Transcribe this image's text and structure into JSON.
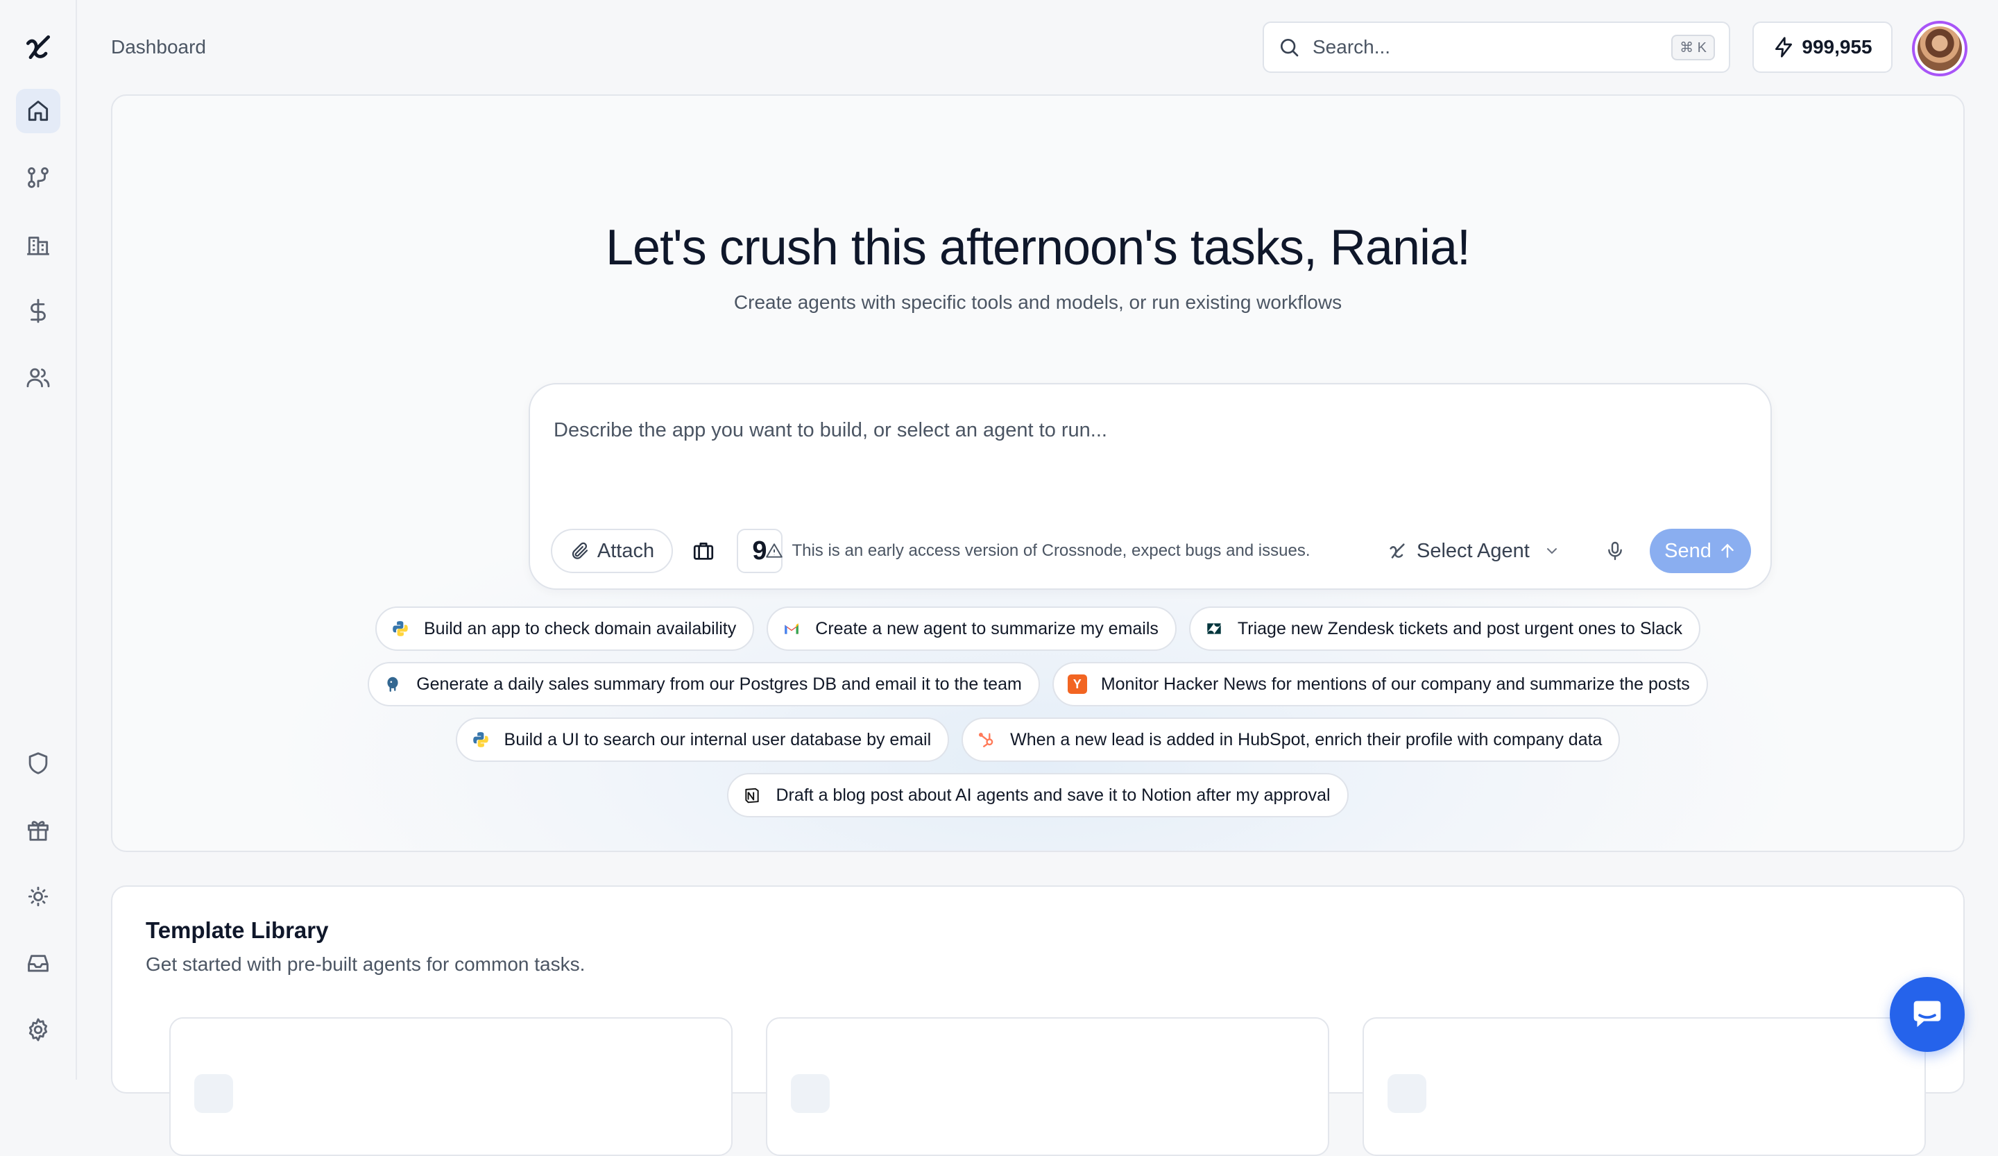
{
  "header": {
    "breadcrumb": "Dashboard",
    "search_placeholder": "Search...",
    "search_shortcut": "⌘ K",
    "credits": "999,955"
  },
  "sidebar": {
    "top_items": [
      {
        "name": "home",
        "icon": "home-icon",
        "active": true
      },
      {
        "name": "workflows",
        "icon": "workflow-icon"
      },
      {
        "name": "organization",
        "icon": "building-icon"
      },
      {
        "name": "billing",
        "icon": "dollar-icon"
      },
      {
        "name": "team",
        "icon": "users-icon"
      }
    ],
    "bottom_items": [
      {
        "name": "security",
        "icon": "shield-icon"
      },
      {
        "name": "rewards",
        "icon": "gift-icon"
      },
      {
        "name": "theme",
        "icon": "sun-icon"
      },
      {
        "name": "inbox",
        "icon": "inbox-icon"
      },
      {
        "name": "settings",
        "icon": "gear-icon"
      }
    ]
  },
  "hero": {
    "title": "Let's crush this afternoon's tasks, Rania!",
    "subtitle": "Create agents with specific tools and models, or run existing workflows",
    "composer": {
      "placeholder": "Describe the app you want to build, or select an agent to run...",
      "attach_label": "Attach",
      "nine_label": "9",
      "select_agent_label": "Select Agent",
      "send_label": "Send"
    },
    "notice": "This is an early access version of Crossnode, expect bugs and issues.",
    "suggestions": [
      [
        {
          "icon": "python-icon",
          "label": "Build an app to check domain availability"
        },
        {
          "icon": "gmail-icon",
          "label": "Create a new agent to summarize my emails"
        },
        {
          "icon": "zendesk-icon",
          "label": "Triage new Zendesk tickets and post urgent ones to Slack"
        }
      ],
      [
        {
          "icon": "postgres-icon",
          "label": "Generate a daily sales summary from our Postgres DB and email it to the team"
        },
        {
          "icon": "hackernews-icon",
          "label": "Monitor Hacker News for mentions of our company and summarize the posts"
        }
      ],
      [
        {
          "icon": "python-icon",
          "label": "Build a UI to search our internal user database by email"
        },
        {
          "icon": "hubspot-icon",
          "label": "When a new lead is added in HubSpot, enrich their profile with company data"
        }
      ],
      [
        {
          "icon": "notion-icon",
          "label": "Draft a blog post about AI agents and save it to Notion after my approval"
        }
      ]
    ]
  },
  "library": {
    "title": "Template Library",
    "subtitle": "Get started with pre-built agents for common tasks."
  },
  "colors": {
    "accent": "#2563eb",
    "send_button": "#8aaef0",
    "avatar_ring": "#a855f7"
  }
}
